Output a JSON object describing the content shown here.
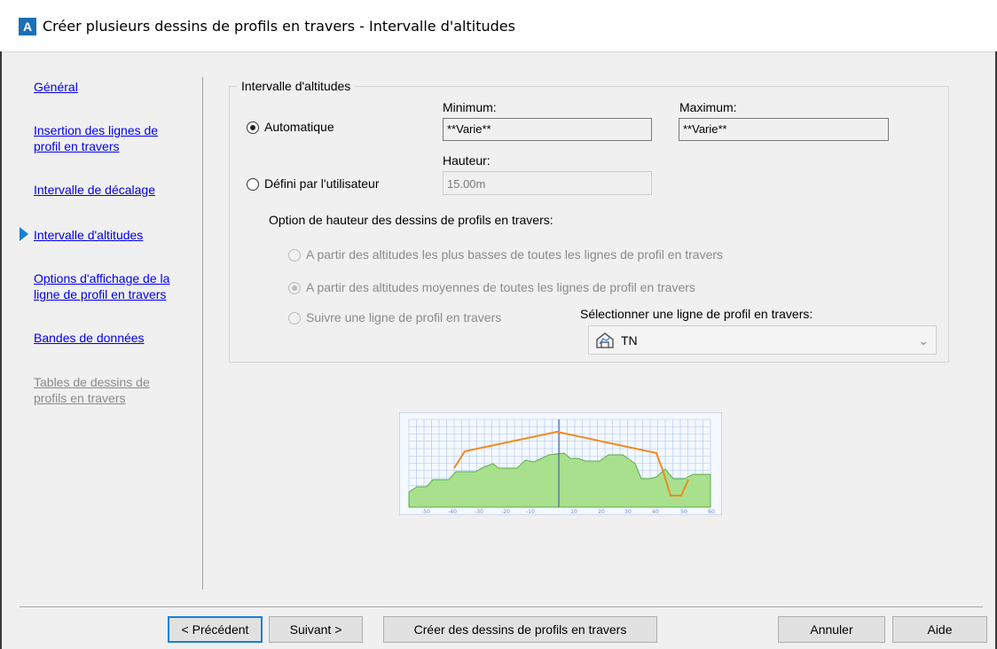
{
  "window": {
    "title": "Créer plusieurs dessins de profils en travers - Intervalle d'altitudes",
    "logo_letter": "A"
  },
  "nav": {
    "items": [
      {
        "label": "Général",
        "state": "link"
      },
      {
        "label": "Insertion des lignes de profil en travers",
        "state": "link"
      },
      {
        "label": "Intervalle de décalage",
        "state": "link"
      },
      {
        "label": "Intervalle d'altitudes",
        "state": "current"
      },
      {
        "label": "Options d'affichage de la ligne de profil en travers",
        "state": "link"
      },
      {
        "label": "Bandes de données",
        "state": "link"
      },
      {
        "label": "Tables de dessins de profils en travers",
        "state": "disabled"
      }
    ]
  },
  "group": {
    "legend": "Intervalle d'altitudes",
    "automatic_label": "Automatique",
    "automatic_selected": true,
    "user_defined_label": "Défini par l'utilisateur",
    "user_defined_selected": false,
    "minimum_label": "Minimum:",
    "minimum_value": "**Varie**",
    "maximum_label": "Maximum:",
    "maximum_value": "**Varie**",
    "height_label": "Hauteur:",
    "height_value": "15.00m",
    "height_option_title": "Option de hauteur des dessins de profils en travers:",
    "options": [
      {
        "label": "A partir des altitudes les plus basses de toutes les lignes de profil en travers",
        "selected": false
      },
      {
        "label": "A partir des altitudes moyennes de toutes les lignes de profil en travers",
        "selected": true
      },
      {
        "label": "Suivre une ligne de profil en travers",
        "selected": false
      }
    ],
    "select_label": "Sélectionner une ligne de profil en travers:",
    "select_value": "TN"
  },
  "preview": {
    "x_ticks": [
      "-50",
      "-40",
      "-30",
      "-20",
      "-10",
      "10",
      "20",
      "30",
      "40",
      "50",
      "60"
    ],
    "colors": {
      "grid": "#a9c4ec",
      "ground": "#7cc96b",
      "profile": "#f28a1e",
      "axis": "#2b4f9e"
    }
  },
  "buttons": {
    "previous": "< Précédent",
    "next": "Suivant >",
    "create": "Créer des dessins de profils en travers",
    "cancel": "Annuler",
    "help": "Aide"
  },
  "colors": {
    "link": "#0000ee",
    "accent": "#1a7fd6",
    "disabled": "#8a8a8a"
  }
}
